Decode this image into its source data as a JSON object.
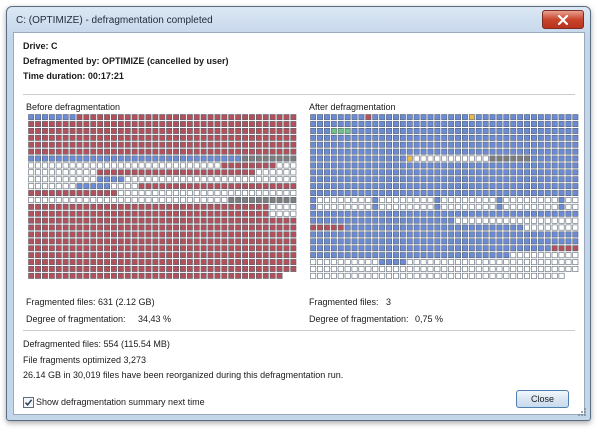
{
  "window": {
    "title": "C: (OPTIMIZE) - defragmentation completed"
  },
  "summary": {
    "drive": "Drive: C",
    "defragmented_by": "Defragmented by: OPTIMIZE (cancelled by user)",
    "time_duration": "Time duration: 00:17:21"
  },
  "before": {
    "label": "Before defragmentation",
    "fragmented_files_label": "Fragmented files: 631 (2.12 GB)",
    "degree_label": "Degree of fragmentation:",
    "degree_value": "34,43 %"
  },
  "after": {
    "label": "After defragmentation",
    "fragmented_files_label": "Fragmented files:",
    "fragmented_files_value": "3",
    "degree_label": "Degree of fragmentation:",
    "degree_value": "0,75 %"
  },
  "results": {
    "defragmented_files": "Defragmented files: 554 (115.54 MB)",
    "fragments_optimized": "File fragments optimized 3,273",
    "reorganized": "26.14 GB in 30,019 files have been reorganized during this defragmentation run."
  },
  "footer": {
    "show_summary_label": "Show defragmentation summary next time",
    "show_summary_checked": true,
    "close_label": "Close"
  },
  "legend_colors": {
    "fragmented": "#b3505a",
    "contiguous": "#6b8bd6",
    "free": "#ffffff",
    "system": "#7d7d7d",
    "metadata": "#e8b84a",
    "movable": "#6cc486"
  }
}
